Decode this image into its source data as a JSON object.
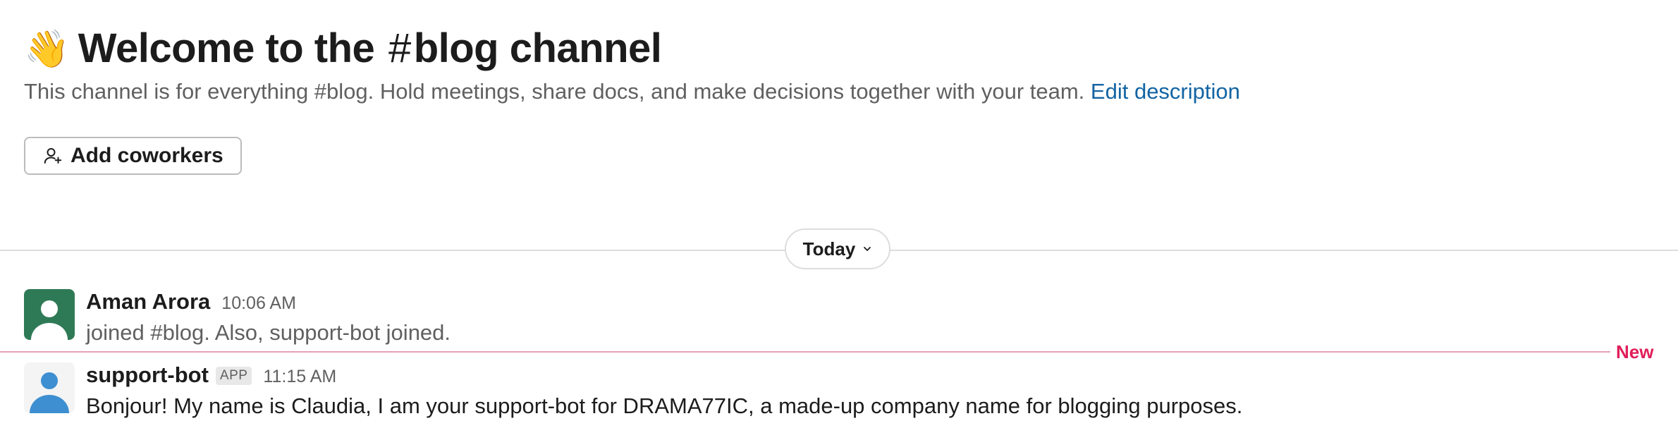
{
  "header": {
    "wave_emoji": "👋",
    "title_prefix": "Welcome to the",
    "hash_symbol": "#",
    "channel_name": "blog channel",
    "description": "This channel is for everything #blog. Hold meetings, share docs, and make decisions together with your team.",
    "edit_description_label": "Edit description",
    "add_coworkers_label": "Add coworkers"
  },
  "divider": {
    "date_label": "Today"
  },
  "new_marker": {
    "label": "New"
  },
  "messages": [
    {
      "author": "Aman Arora",
      "timestamp": "10:06 AM",
      "text": "joined #blog. Also, support-bot joined.",
      "avatar_color": "#2f7a56"
    },
    {
      "author": "support-bot",
      "badge": "APP",
      "timestamp": "11:15 AM",
      "text": "Bonjour! My name is Claudia, I am your support-bot for DRAMA77IC, a made-up company name for blogging purposes.",
      "avatar_color": "#3d8fd1"
    }
  ],
  "colors": {
    "link": "#1264a3",
    "new_accent": "#e01e5a",
    "muted_text": "#616061"
  }
}
